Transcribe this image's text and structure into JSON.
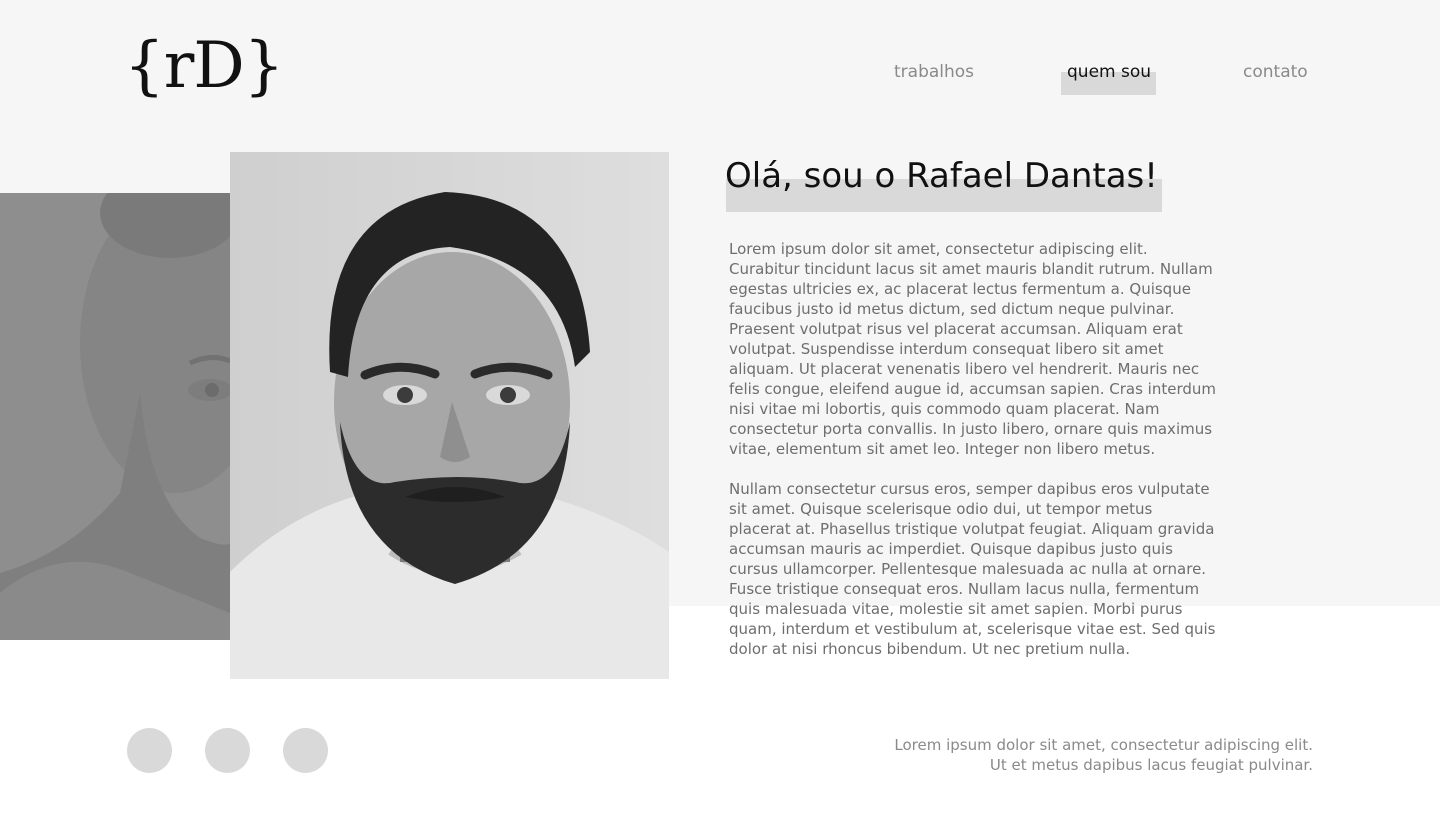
{
  "header": {
    "logo_text": "{rD}",
    "nav": [
      {
        "label": "trabalhos"
      },
      {
        "label": "quem sou"
      },
      {
        "label": "contato"
      }
    ]
  },
  "about": {
    "title": "Olá, sou o Rafael Dantas!",
    "paragraphs": [
      "Lorem ipsum dolor sit amet, consectetur adipiscing elit. Curabitur tincidunt lacus sit amet mauris blandit rutrum. Nullam egestas ultricies ex, ac placerat lectus fermentum a. Quisque faucibus justo id metus dictum, sed dictum neque pulvinar. Praesent volutpat risus vel placerat accumsan. Aliquam erat volutpat. Suspendisse interdum consequat libero sit amet aliquam. Ut placerat venenatis libero vel hendrerit. Mauris nec felis congue, eleifend augue id, accumsan sapien. Cras interdum nisi vitae mi lobortis, quis commodo quam placerat. Nam consectetur porta convallis. In justo libero, ornare quis maximus vitae, elementum sit amet leo. Integer non libero metus.",
      "Nullam consectetur cursus eros, semper dapibus eros vulputate sit amet. Quisque scelerisque odio dui, ut tempor metus placerat at. Phasellus tristique volutpat feugiat. Aliquam gravida accumsan mauris ac imperdiet. Quisque dapibus justo quis cursus ullamcorper. Pellentesque malesuada ac nulla at ornare. Fusce tristique consequat eros. Nullam lacus nulla, fermentum quis malesuada vitae, molestie sit amet sapien. Morbi purus quam, interdum et vestibulum at, scelerisque vitae est. Sed quis dolor at nisi rhoncus bibendum. Ut nec pretium nulla."
    ]
  },
  "footer": {
    "social_icon_count": 3,
    "lines": [
      "Lorem ipsum dolor sit amet, consectetur adipiscing elit.",
      "Ut et metus dapibus lacus feugiat pulvinar."
    ]
  },
  "colors": {
    "background": "#ffffff",
    "band": "#f6f6f6",
    "highlight": "#d9d9d9",
    "text_dark": "#111111",
    "text_muted": "#6e6e6e"
  }
}
